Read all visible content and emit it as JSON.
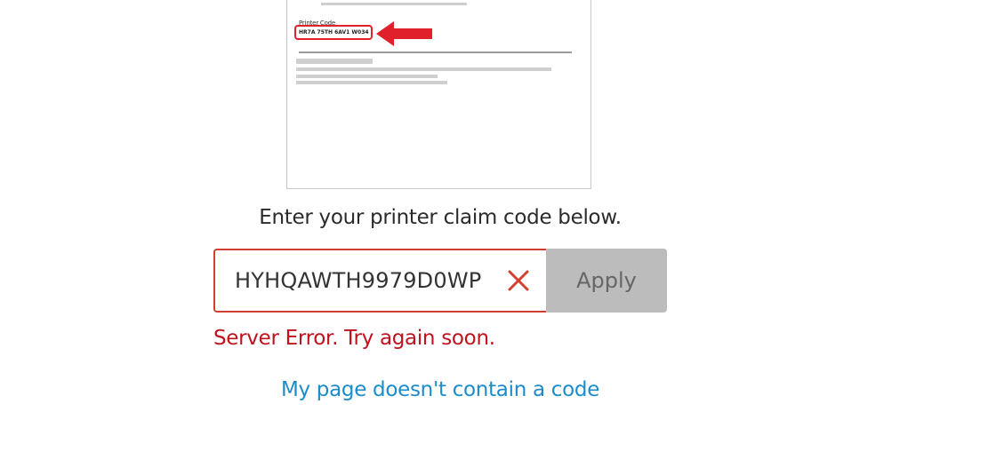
{
  "illustration": {
    "label": "Printer Code",
    "code": "HR7A 75TH 6AV1 W034"
  },
  "instruction": "Enter your printer claim code below.",
  "code_field": {
    "value": "HYHQAWTH9979D0WP",
    "clear_icon": "close-x-icon"
  },
  "apply_button": {
    "label": "Apply"
  },
  "error_message": "Server Error. Try again soon.",
  "no_code_link": "My page doesn't contain a code",
  "colors": {
    "error": "#c0121c",
    "field_border": "#d0402e",
    "link": "#1a8ccb",
    "button_bg": "#bcbcbc",
    "highlight": "#e0202a"
  }
}
